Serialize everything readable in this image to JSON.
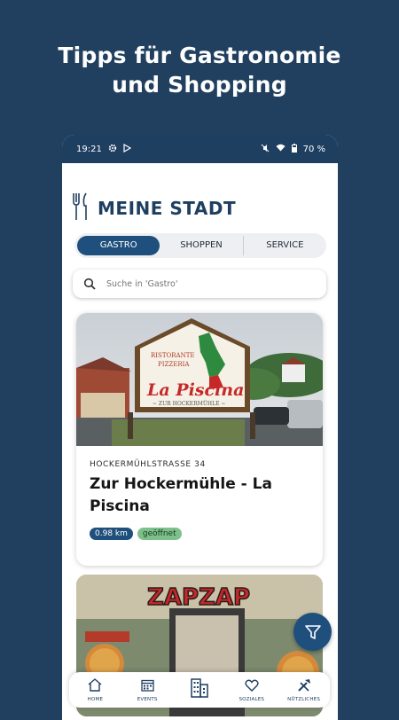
{
  "headline": {
    "line1": "Tipps für Gastronomie",
    "line2": "und Shopping"
  },
  "status_bar": {
    "time": "19:21",
    "battery": "70 %"
  },
  "app": {
    "logo_text": "MEINE STADT"
  },
  "tabs": [
    {
      "label": "GASTRO",
      "active": true
    },
    {
      "label": "SHOPPEN",
      "active": false
    },
    {
      "label": "SERVICE",
      "active": false
    }
  ],
  "search": {
    "placeholder": "Suche in 'Gastro'"
  },
  "cards": [
    {
      "address": "HOCKERMÜHLSTRASSE 34",
      "title": "Zur Hockermühle - La Piscina",
      "distance": "0.98 km",
      "status": "geöffnet",
      "sign": {
        "line1": "RISTORANTE",
        "line2": "PIZZERIA",
        "name": "La Piscina",
        "sub": "~ ZUR HOCKERMÜHLE ~"
      }
    },
    {
      "sign": {
        "name": "ZAPZAP"
      }
    }
  ],
  "bottom_nav": [
    {
      "label": "HOME",
      "icon": "home-icon"
    },
    {
      "label": "EVENTS",
      "icon": "calendar-icon"
    },
    {
      "label": "",
      "icon": "buildings-icon"
    },
    {
      "label": "SOZIALES",
      "icon": "heart-icon"
    },
    {
      "label": "NÜTZLICHES",
      "icon": "tools-icon"
    }
  ],
  "colors": {
    "background": "#21405f",
    "primary": "#1f4f7c",
    "open_badge": "#7ec08b"
  }
}
